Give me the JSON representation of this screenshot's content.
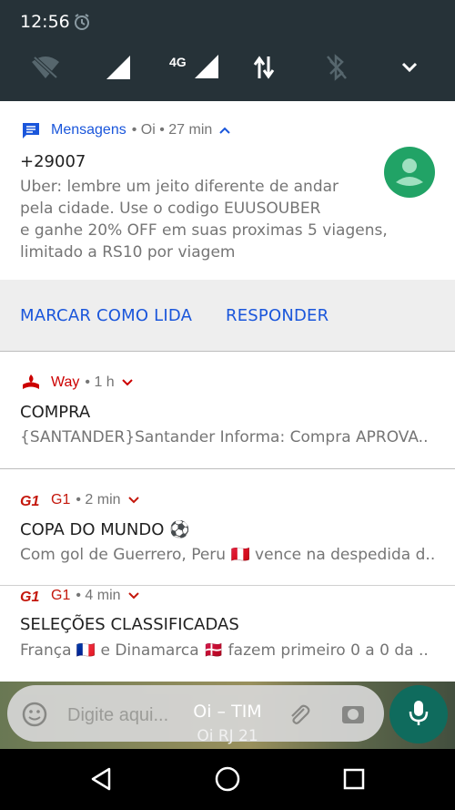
{
  "status": {
    "time": "12:56",
    "network_label": "4G",
    "icons": [
      "alarm-icon",
      "wifi-off-icon",
      "signal-icon",
      "signal-4g-icon",
      "data-transfer-icon",
      "bluetooth-off-icon",
      "expand-icon"
    ]
  },
  "notifications": [
    {
      "app": "Mensagens",
      "meta": "• Oi • 27 min",
      "title": "+29007",
      "body": [
        "Uber: lembre um jeito diferente de andar",
        "pela cidade. Use o codigo EUUSOUBER",
        "e ganhe 20% OFF em suas proximas 5 viagens,",
        "limitado a RS10 por viagem"
      ],
      "actions": [
        "MARCAR COMO LIDA",
        "RESPONDER"
      ],
      "accent": "#1a56db"
    },
    {
      "app": "Way",
      "meta": "• 1 h",
      "title": "COMPRA",
      "body": "{SANTANDER}Santander Informa: Compra APROVA..",
      "accent": "#cc0000"
    },
    {
      "app": "G1",
      "meta": "• 2 min",
      "title": "COPA DO MUNDO ⚽",
      "body": "Com gol de Guerrero, Peru 🇵🇪 vence na despedida d..",
      "accent": "#c4170c"
    },
    {
      "app": "G1",
      "meta": "• 4 min",
      "title": "SELEÇÕES CLASSIFICADAS",
      "body": "França 🇫🇷 e Dinamarca 🇩🇰 fazem primeiro 0 a 0 da ..",
      "accent": "#c4170c"
    }
  ],
  "background_app": {
    "input_placeholder": "Digite aqui...",
    "carrier": "Oi – TIM",
    "carrier_sub": "Oi RJ 21"
  },
  "navbar": [
    "back-icon",
    "home-icon",
    "recents-icon"
  ]
}
